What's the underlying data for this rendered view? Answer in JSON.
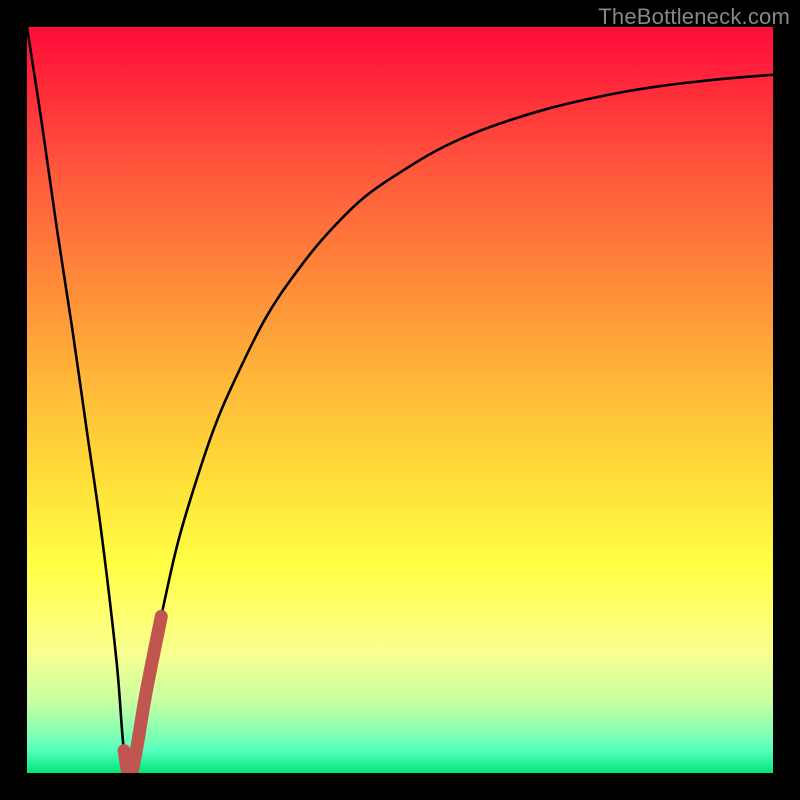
{
  "attribution": "TheBottleneck.com",
  "colors": {
    "frame": "#000000",
    "curve": "#000000",
    "highlight": "#c1554f"
  },
  "chart_data": {
    "type": "line",
    "title": "",
    "xlabel": "",
    "ylabel": "",
    "xlim": [
      0,
      100
    ],
    "ylim": [
      0,
      100
    ],
    "series": [
      {
        "name": "bottleneck-curve",
        "x": [
          0,
          2,
          4,
          6,
          8,
          10,
          12,
          13,
          14,
          16,
          18,
          20,
          22,
          25,
          28,
          32,
          36,
          40,
          45,
          50,
          55,
          60,
          65,
          70,
          75,
          80,
          85,
          90,
          95,
          100
        ],
        "y": [
          100,
          87,
          73,
          60,
          46,
          32,
          15,
          3,
          0,
          11,
          21,
          30,
          37,
          46,
          53,
          61,
          67,
          72,
          77,
          80.5,
          83.5,
          85.8,
          87.6,
          89.1,
          90.3,
          91.3,
          92.1,
          92.7,
          93.2,
          93.6
        ]
      },
      {
        "name": "highlight-segment",
        "x": [
          13,
          14,
          16,
          18
        ],
        "y": [
          3,
          0,
          11,
          21
        ]
      }
    ]
  }
}
